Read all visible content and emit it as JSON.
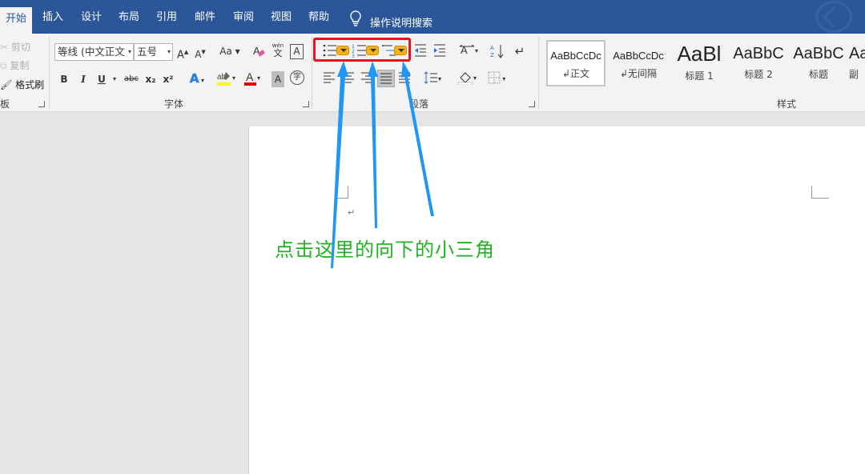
{
  "tabs": [
    {
      "label": "开始",
      "active": true
    },
    {
      "label": "插入"
    },
    {
      "label": "设计"
    },
    {
      "label": "布局"
    },
    {
      "label": "引用"
    },
    {
      "label": "邮件"
    },
    {
      "label": "审阅"
    },
    {
      "label": "视图"
    },
    {
      "label": "帮助"
    }
  ],
  "tell_me": "操作说明搜索",
  "clipboard": {
    "cut": "剪切",
    "copy": "复制",
    "format_painter": "格式刷",
    "group_label": "板"
  },
  "font": {
    "family": "等线 (中文正文",
    "size": "五号",
    "group_label": "字体",
    "change_case": "Aa",
    "bold": "B",
    "italic": "I",
    "underline": "U",
    "strikethrough": "abc",
    "subscript": "x₂",
    "superscript": "x²",
    "grow": "A",
    "shrink": "A",
    "phonetic": "wén",
    "phonetic_char": "文",
    "char_border": "A",
    "font_color": "A",
    "char_shading": "A",
    "enclose": "字"
  },
  "paragraph": {
    "group_label": "段落",
    "paragraph_mark": "↵"
  },
  "styles": {
    "group_label": "样式",
    "items": [
      {
        "sample": "AaBbCcDc",
        "name": "↲正文",
        "selected": true
      },
      {
        "sample": "AaBbCcDc",
        "name": "↲无间隔"
      },
      {
        "sample": "AaBl",
        "name": "标题 1"
      },
      {
        "sample": "AaBbC",
        "name": "标题 2"
      },
      {
        "sample": "AaBbC",
        "name": "标题"
      },
      {
        "sample": "Aa",
        "name": "副"
      }
    ]
  },
  "document": {
    "paragraph_mark": "↵",
    "caption": "点击这里的向下的小三角"
  },
  "colors": {
    "tab_bar": "#2b579a",
    "highlight_box": "#e8131e",
    "dropdown_badge": "#f7b21b",
    "arrow": "#2196f3",
    "caption": "#22b322",
    "font_color_bar": "#e00000",
    "highlight_color_bar": "#ffff00"
  }
}
